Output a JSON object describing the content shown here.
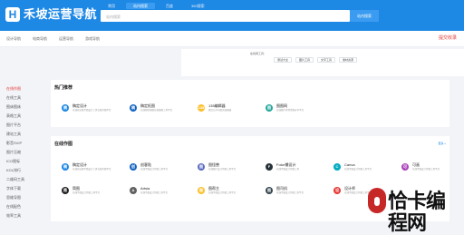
{
  "header": {
    "logo_letter": "H",
    "logo_text": "禾坡运营导航",
    "tabs": [
      "常用",
      "站内搜索",
      "百度",
      "360搜索"
    ],
    "search_placeholder": "站内搜索",
    "search_button": "站内搜索",
    "colors": {
      "bar": "#1e88e5",
      "accent": "#3a9bf0"
    }
  },
  "topnav": {
    "items": [
      "设计导航",
      "电商导航",
      "运营导航",
      "游戏导航"
    ],
    "submit": "提交收录"
  },
  "filter": {
    "label": "在线者工具：",
    "chips": [
      "测试大全",
      "图片工具",
      "文字工具",
      "素材资源"
    ]
  },
  "sidebar": {
    "items": [
      "在线作图",
      "在线工具",
      "图床图床",
      "表格工具",
      "图片平台",
      "建站工具",
      "影音SVIP",
      "图片压缩",
      "ICO图标",
      "KOL排行",
      "二维码工具",
      "字体下载",
      "思维导图",
      "在线配色",
      "效率工具"
    ],
    "active_index": 0
  },
  "hot": {
    "title": "热门推荐",
    "cards": [
      {
        "icon": "creative-logo-icon",
        "color": "#1e88e5",
        "glyph": "稿",
        "name": "稿定设计",
        "desc": "在线商业级平面设计工具在线作图平台"
      },
      {
        "icon": "logo-icon",
        "color": "#1565c0",
        "glyph": "稿",
        "name": "稿定抠图",
        "desc": "在线智能抠图在线抠图工具平台"
      },
      {
        "icon": "editor-icon",
        "color": "#fbc02d",
        "glyph": "135",
        "name": "135编辑器",
        "desc": "微信公众号图文编辑器"
      },
      {
        "icon": "pic-icon",
        "color": "#26a69a",
        "glyph": "图",
        "name": "图图网",
        "desc": "在线图片素材资源分享平台"
      }
    ]
  },
  "online": {
    "title": "在线作图",
    "more": "更多 »",
    "cards": [
      {
        "icon": "creative-logo-icon",
        "color": "#1e88e5",
        "glyph": "稿",
        "name": "稿定设计",
        "desc": "在线商业级平面设计工具在线作图平台"
      },
      {
        "icon": "design-icon",
        "color": "#1565c0",
        "glyph": "创",
        "name": "创客贴",
        "desc": "在线平面设计作图工具平台"
      },
      {
        "icon": "canvas-icon",
        "color": "#5c6bc0",
        "glyph": "图",
        "name": "图怪兽",
        "desc": "在线图片设计作图工具平台"
      },
      {
        "icon": "fotor-icon",
        "color": "#263238",
        "glyph": "F",
        "name": "Fotor懒设计",
        "desc": "在线平面设计作图工具"
      },
      {
        "icon": "canva-icon",
        "color": "#00acc1",
        "glyph": "C",
        "name": "Canva",
        "desc": "在线平面设计作图工具平台"
      },
      {
        "icon": "gaoding-icon",
        "color": "#ab47bc",
        "glyph": "可",
        "name": "可画",
        "desc": "在线平面设计作图工具平台"
      },
      {
        "icon": "pinxi-icon",
        "color": "#212121",
        "glyph": "简",
        "name": "简图",
        "desc": "在线平面设计作图工具平台"
      },
      {
        "icon": "artsia-icon",
        "color": "#616161",
        "glyph": "A",
        "name": "Artsia",
        "desc": "在线平面设计作图工具平台"
      },
      {
        "icon": "tuyu-icon",
        "color": "#fbc02d",
        "glyph": "图",
        "name": "图帮主",
        "desc": "在线平面设计作图工具平台"
      },
      {
        "icon": "tuyitu-icon",
        "color": "#37474f",
        "glyph": "图",
        "name": "图司机",
        "desc": "在线平面设计作图工具平台"
      },
      {
        "icon": "mojing-icon",
        "color": "#e53935",
        "glyph": "设",
        "name": "设计师",
        "desc": "在线平面设计作图工具平台"
      }
    ]
  },
  "watermark": {
    "text": "恰卡编程网",
    "color": "#c62828"
  }
}
